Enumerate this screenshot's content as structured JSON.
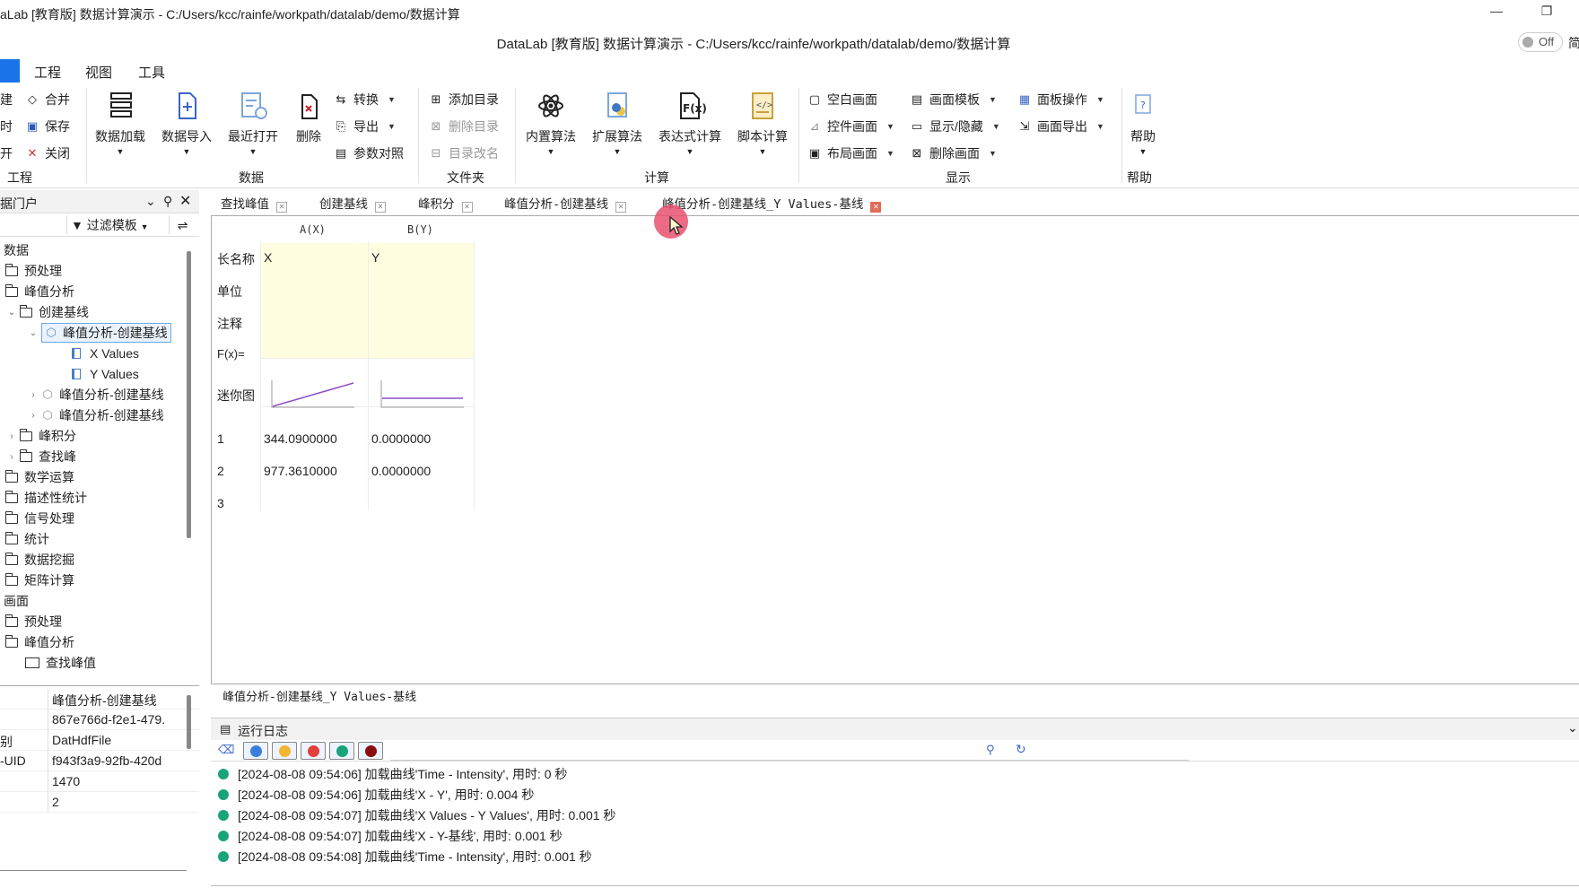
{
  "window": {
    "title": "aLab [教育版] 数据计算演示 - C:/Users/kcc/rainfe/workpath/datalab/demo/数据计算",
    "subtitle": "DataLab [教育版] 数据计算演示 - C:/Users/kcc/rainfe/workpath/datalab/demo/数据计算",
    "toggle_label": "Off",
    "toggle_tail": "简"
  },
  "menu": {
    "items": [
      "工程",
      "视图",
      "工具"
    ]
  },
  "ribbon": {
    "project": {
      "items": [
        "建",
        "合并",
        "时",
        "保存",
        "开",
        "关闭"
      ],
      "label": "工程"
    },
    "data": {
      "load": "数据加载",
      "import": "数据导入",
      "recent": "最近打开",
      "delete": "删除",
      "convert": "转换",
      "export": "导出",
      "param": "参数对照",
      "label": "数据"
    },
    "folder": {
      "add": "添加目录",
      "remove": "删除目录",
      "rename": "目录改名",
      "label": "文件夹"
    },
    "calc": {
      "builtin": "内置算法",
      "ext": "扩展算法",
      "expr": "表达式计算",
      "script": "脚本计算",
      "label": "计算"
    },
    "display": {
      "blank": "空白画面",
      "control": "控件画面",
      "layout": "布局画面",
      "template": "画面模板",
      "showhide": "显示/隐藏",
      "delview": "删除画面",
      "panel": "面板操作",
      "viewexport": "画面导出",
      "label": "显示"
    },
    "help": {
      "btn": "帮助",
      "label": "帮助"
    }
  },
  "left_panel": {
    "title": "据门户",
    "filter_label": "过滤模板",
    "tree": [
      {
        "label": "数据",
        "type": "root"
      },
      {
        "label": "预处理",
        "type": "folder"
      },
      {
        "label": "峰值分析",
        "type": "folder"
      },
      {
        "label": "创建基线",
        "type": "folder"
      },
      {
        "label": "峰值分析-创建基线",
        "type": "dataset"
      },
      {
        "label": "X Values",
        "type": "column"
      },
      {
        "label": "Y Values",
        "type": "column"
      },
      {
        "label": "峰值分析-创建基线",
        "type": "dataset"
      },
      {
        "label": "峰值分析-创建基线",
        "type": "dataset"
      },
      {
        "label": "峰积分",
        "type": "folder"
      },
      {
        "label": "查找峰",
        "type": "folder"
      },
      {
        "label": "数学运算",
        "type": "folder"
      },
      {
        "label": "描述性统计",
        "type": "folder"
      },
      {
        "label": "信号处理",
        "type": "folder"
      },
      {
        "label": "统计",
        "type": "folder"
      },
      {
        "label": "数据挖掘",
        "type": "folder"
      },
      {
        "label": "矩阵计算",
        "type": "folder"
      },
      {
        "label": "画面",
        "type": "root"
      },
      {
        "label": "预处理",
        "type": "folder"
      },
      {
        "label": "峰值分析",
        "type": "folder"
      },
      {
        "label": "查找峰值",
        "type": "view"
      }
    ],
    "props": [
      {
        "k": "",
        "v": "峰值分析-创建基线"
      },
      {
        "k": "",
        "v": "867e766d-f2e1-479."
      },
      {
        "k": "别",
        "v": "DatHdfFile"
      },
      {
        "k": "-UID",
        "v": "f943f3a9-92fb-420d"
      },
      {
        "k": "",
        "v": "1470"
      },
      {
        "k": "",
        "v": "2"
      }
    ]
  },
  "tabs": [
    {
      "label": "查找峰值"
    },
    {
      "label": "创建基线"
    },
    {
      "label": "峰积分"
    },
    {
      "label": "峰值分析-创建基线"
    },
    {
      "label": "峰值分析-创建基线_Y Values-基线"
    }
  ],
  "grid": {
    "columns": [
      "A(X)",
      "B(Y)"
    ],
    "meta_rows": [
      "长名称",
      "单位",
      "注释",
      "F(x)=",
      "迷你图"
    ],
    "long_names": [
      "X",
      "Y"
    ],
    "rows": [
      {
        "idx": "1",
        "a": "344.0900000",
        "b": "0.0000000"
      },
      {
        "idx": "2",
        "a": "977.3610000",
        "b": "0.0000000"
      },
      {
        "idx": "3",
        "a": "",
        "b": ""
      }
    ],
    "sheet_name": "峰值分析-创建基线_Y Values-基线"
  },
  "log": {
    "title": "运行日志",
    "lines": [
      "[2024-08-08 09:54:06] 加载曲线'Time - Intensity', 用时: 0 秒",
      "[2024-08-08 09:54:06] 加载曲线'X - Y', 用时: 0.004 秒",
      "[2024-08-08 09:54:07] 加载曲线'X Values - Y Values', 用时: 0.001 秒",
      "[2024-08-08 09:54:07] 加载曲线'X - Y-基线', 用时: 0.001 秒",
      "[2024-08-08 09:54:08] 加载曲线'Time - Intensity', 用时: 0.001 秒"
    ]
  },
  "colors": {
    "accent": "#1a73e8",
    "yellow": "#fffde0",
    "log_ok": "#1aa37a",
    "cursor": "#e8506e"
  }
}
